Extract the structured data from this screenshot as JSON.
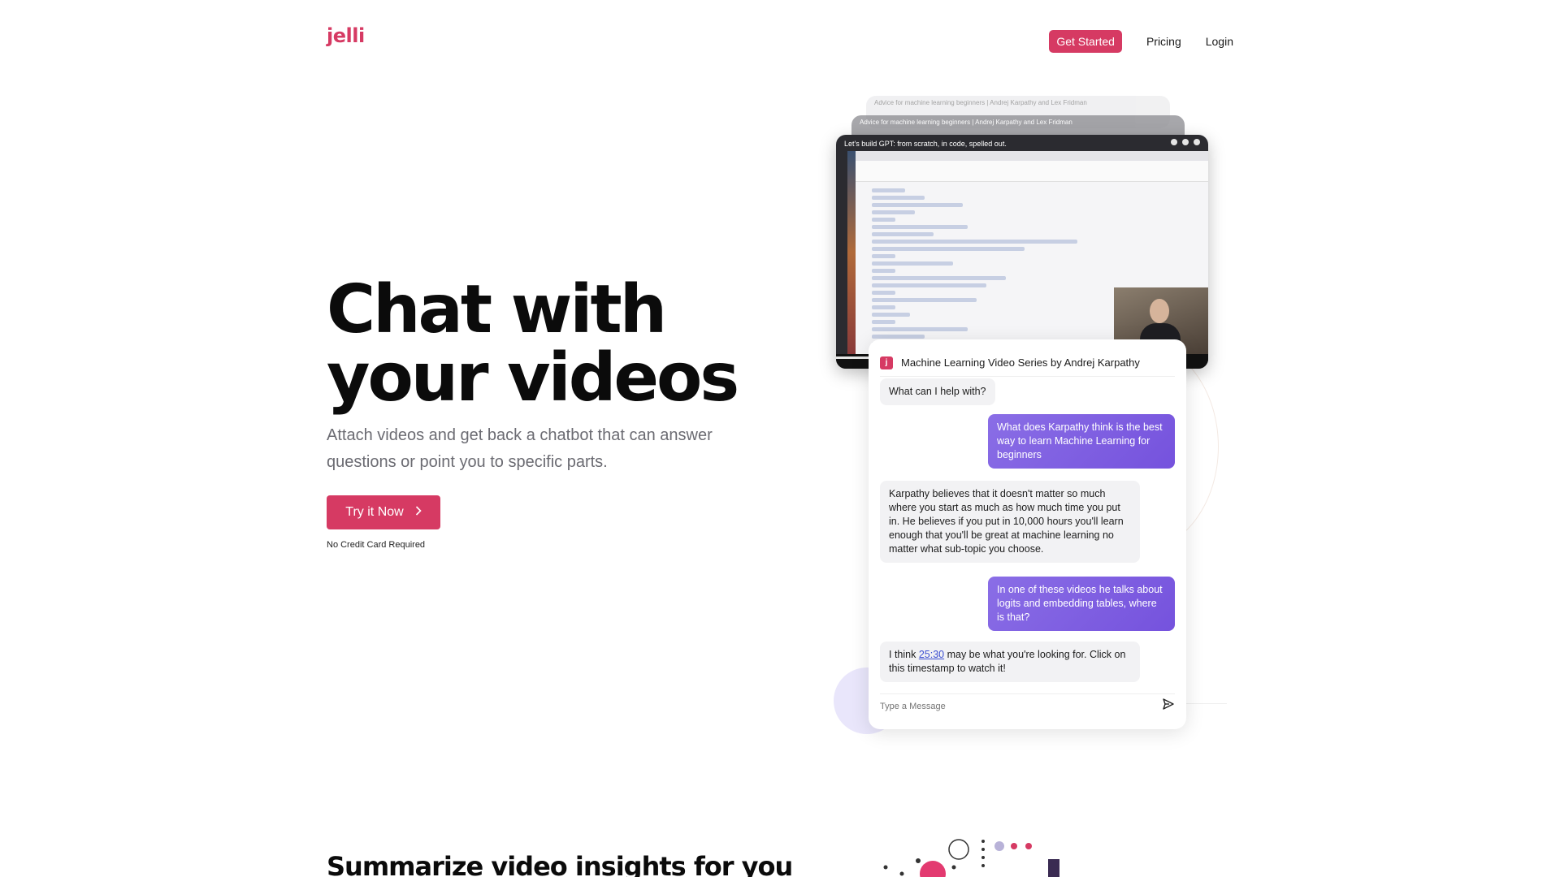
{
  "brand": {
    "logo": "jelli",
    "accent": "#d63a63",
    "purple": "#7552dd"
  },
  "nav": {
    "get_started": "Get Started",
    "pricing": "Pricing",
    "login": "Login"
  },
  "hero": {
    "title_line1": "Chat with",
    "title_line2": "your videos",
    "subtitle": "Attach videos and get back a chatbot that can answer questions or point you to specific parts.",
    "cta": "Try it Now",
    "cta_icon": "chevron-right-icon",
    "note": "No Credit Card Required"
  },
  "videos": {
    "back2_title": "Advice for machine learning beginners | Andrej Karpathy and Lex Fridman",
    "back1_title": "Advice for machine learning beginners | Andrej Karpathy and Lex Fridman",
    "main_title": "Let's build GPT: from scratch, in code, spelled out.",
    "progress": 0.72
  },
  "chat": {
    "badge": "j",
    "title": "Machine Learning Video Series by Andrej Karpathy",
    "messages": {
      "m1": "What can I help with?",
      "m2": "What does Karpathy think is the best way to learn Machine Learning for beginners",
      "m3": "Karpathy believes that it doesn't matter so much where you start as much as how much time you put in. He believes if you put in 10,000 hours you'll learn enough that you'll be great at machine learning no matter what sub-topic you choose.",
      "m4": "In one of these videos he talks about logits and embedding tables, where is that?",
      "m5_before": "I think ",
      "m5_timestamp": "25:30",
      "m5_after": " may be what you're looking for. Click on this timestamp to watch it!"
    },
    "input_placeholder": "Type a Message",
    "send_icon": "send-icon"
  },
  "section2": {
    "title": "Summarize video insights for you"
  }
}
